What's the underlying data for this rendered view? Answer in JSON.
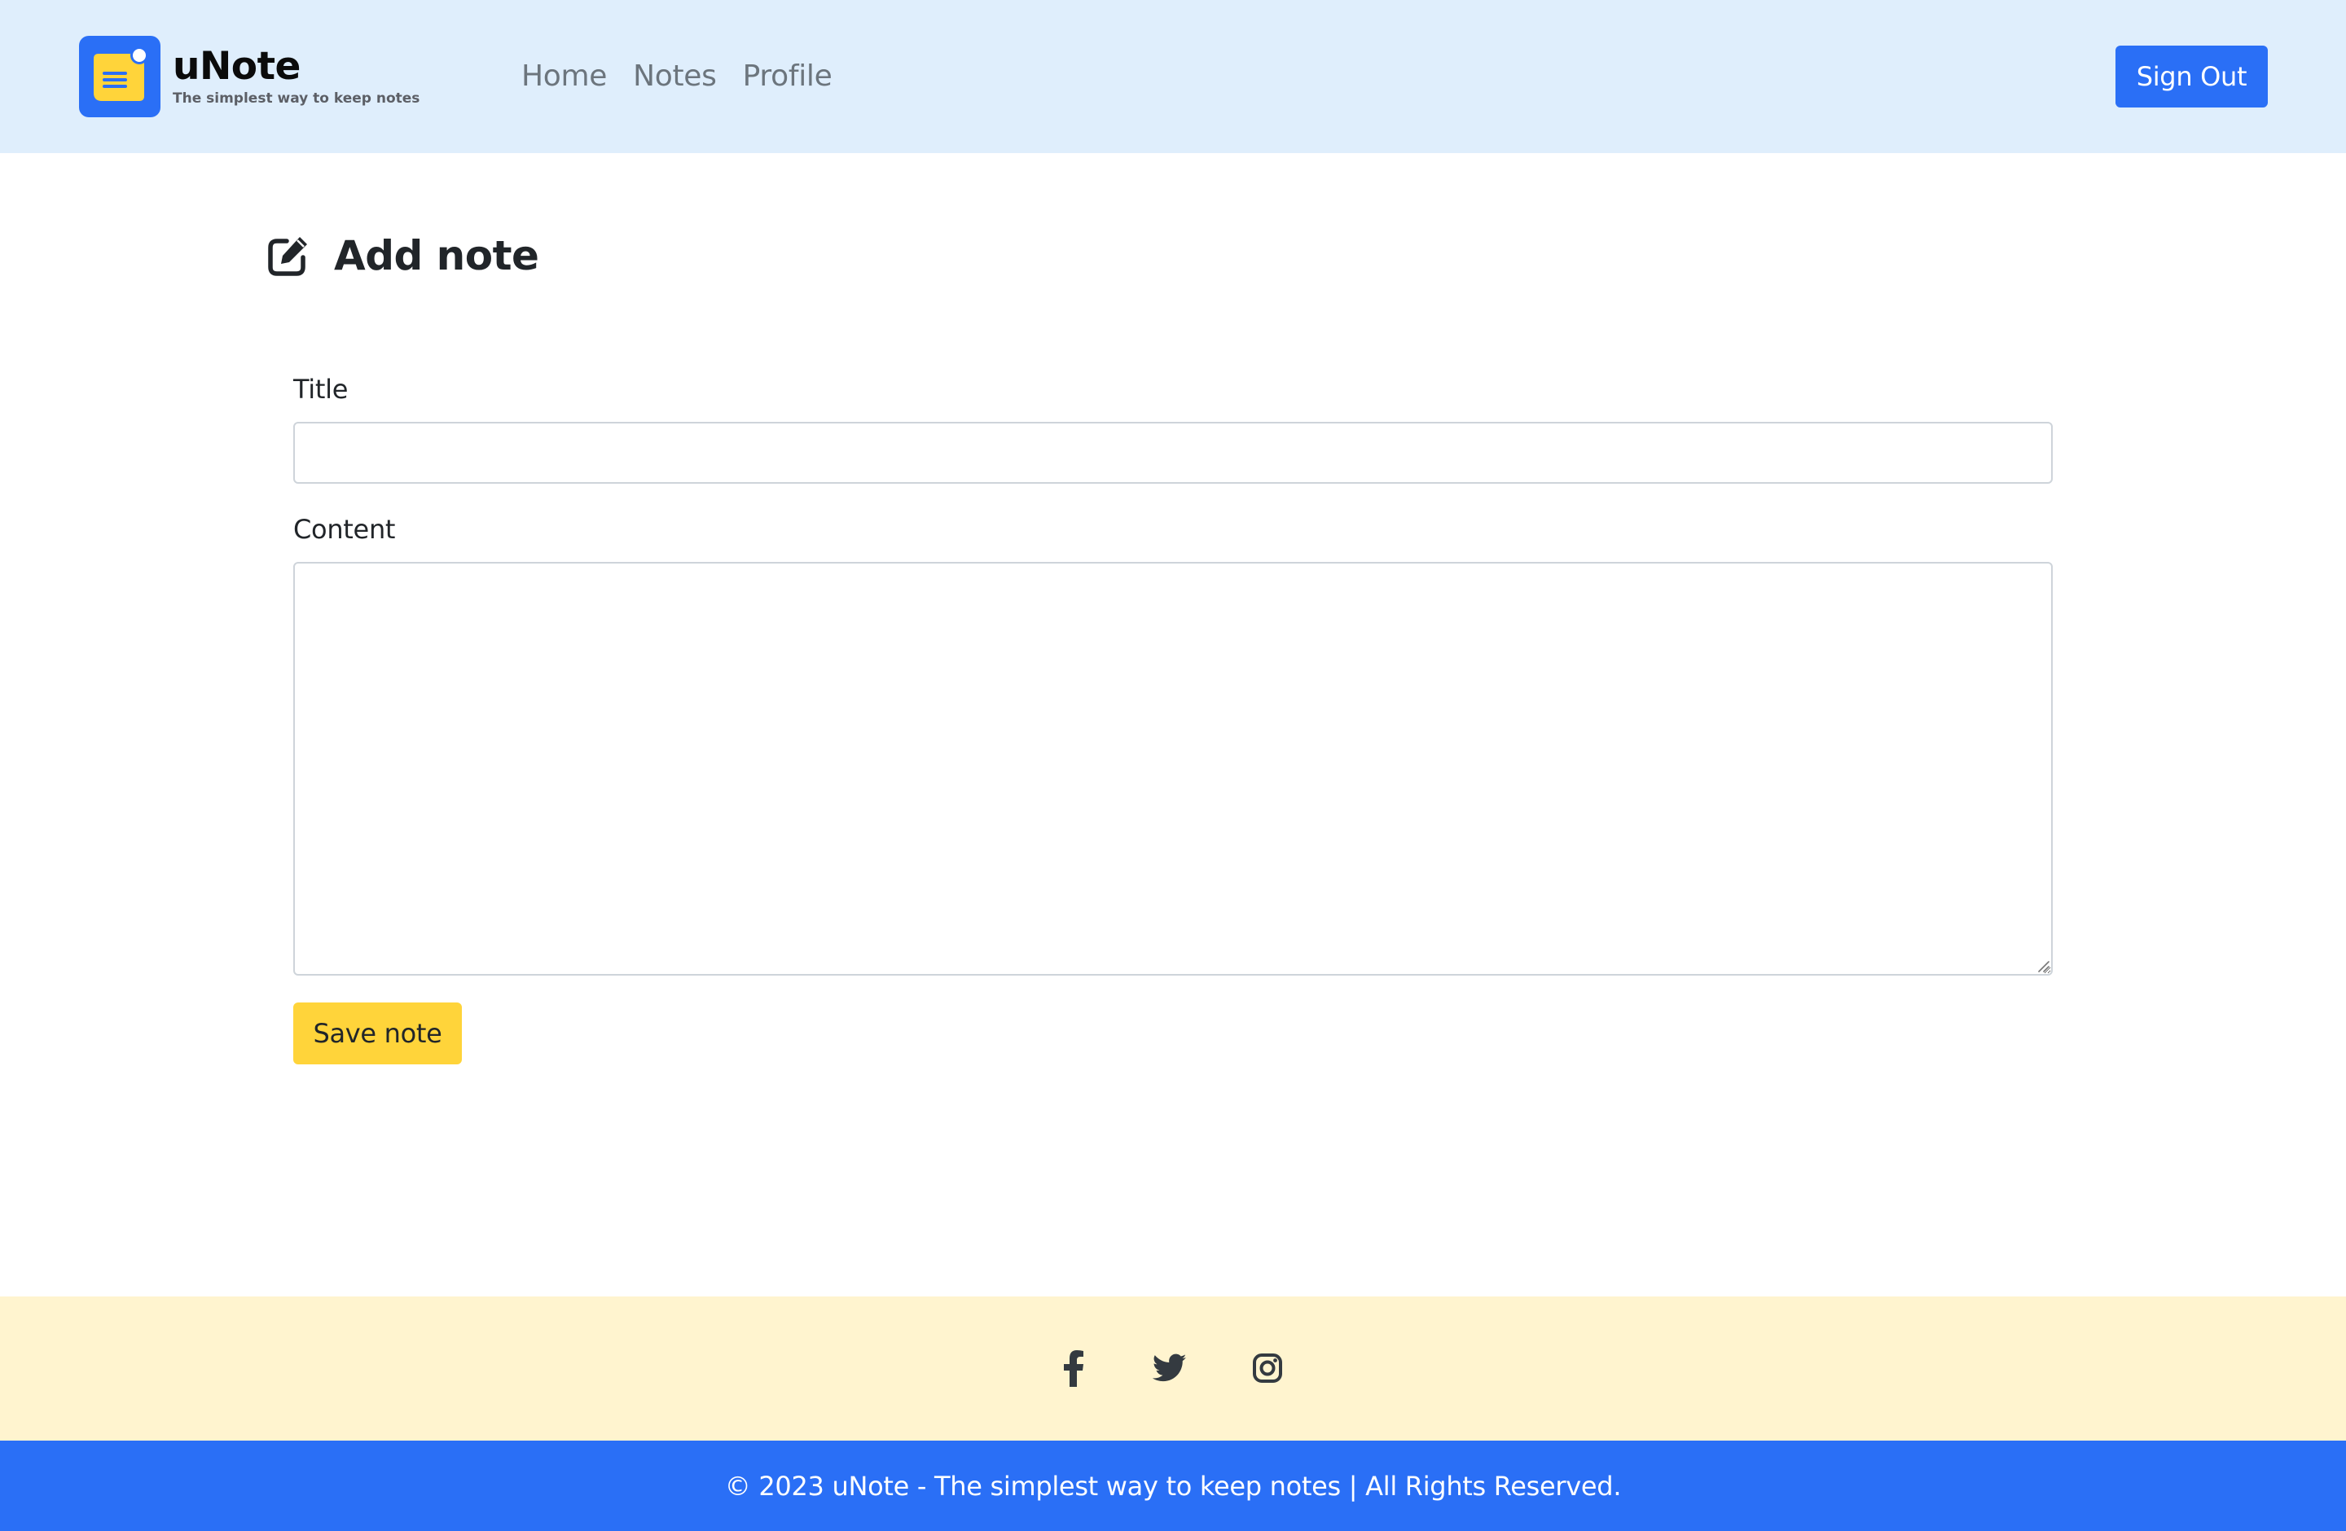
{
  "header": {
    "brand_name": "uNote",
    "brand_tagline": "The simplest way to keep notes",
    "nav": [
      {
        "label": "Home"
      },
      {
        "label": "Notes"
      },
      {
        "label": "Profile"
      }
    ],
    "signout_label": "Sign Out"
  },
  "main": {
    "heading": "Add note",
    "heading_icon": "edit-square-icon",
    "form": {
      "title_label": "Title",
      "title_value": "",
      "content_label": "Content",
      "content_value": "",
      "save_label": "Save note"
    }
  },
  "footer": {
    "social": [
      {
        "name": "facebook-icon"
      },
      {
        "name": "twitter-icon"
      },
      {
        "name": "instagram-icon"
      }
    ],
    "copyright": "© 2023 uNote - The simplest way to keep notes | All Rights Reserved."
  },
  "colors": {
    "header_bg": "#dfeefc",
    "primary": "#2a6ff6",
    "accent_yellow": "#ffd43a",
    "social_bar_bg": "#fff4cf",
    "nav_text": "#6c757d"
  }
}
